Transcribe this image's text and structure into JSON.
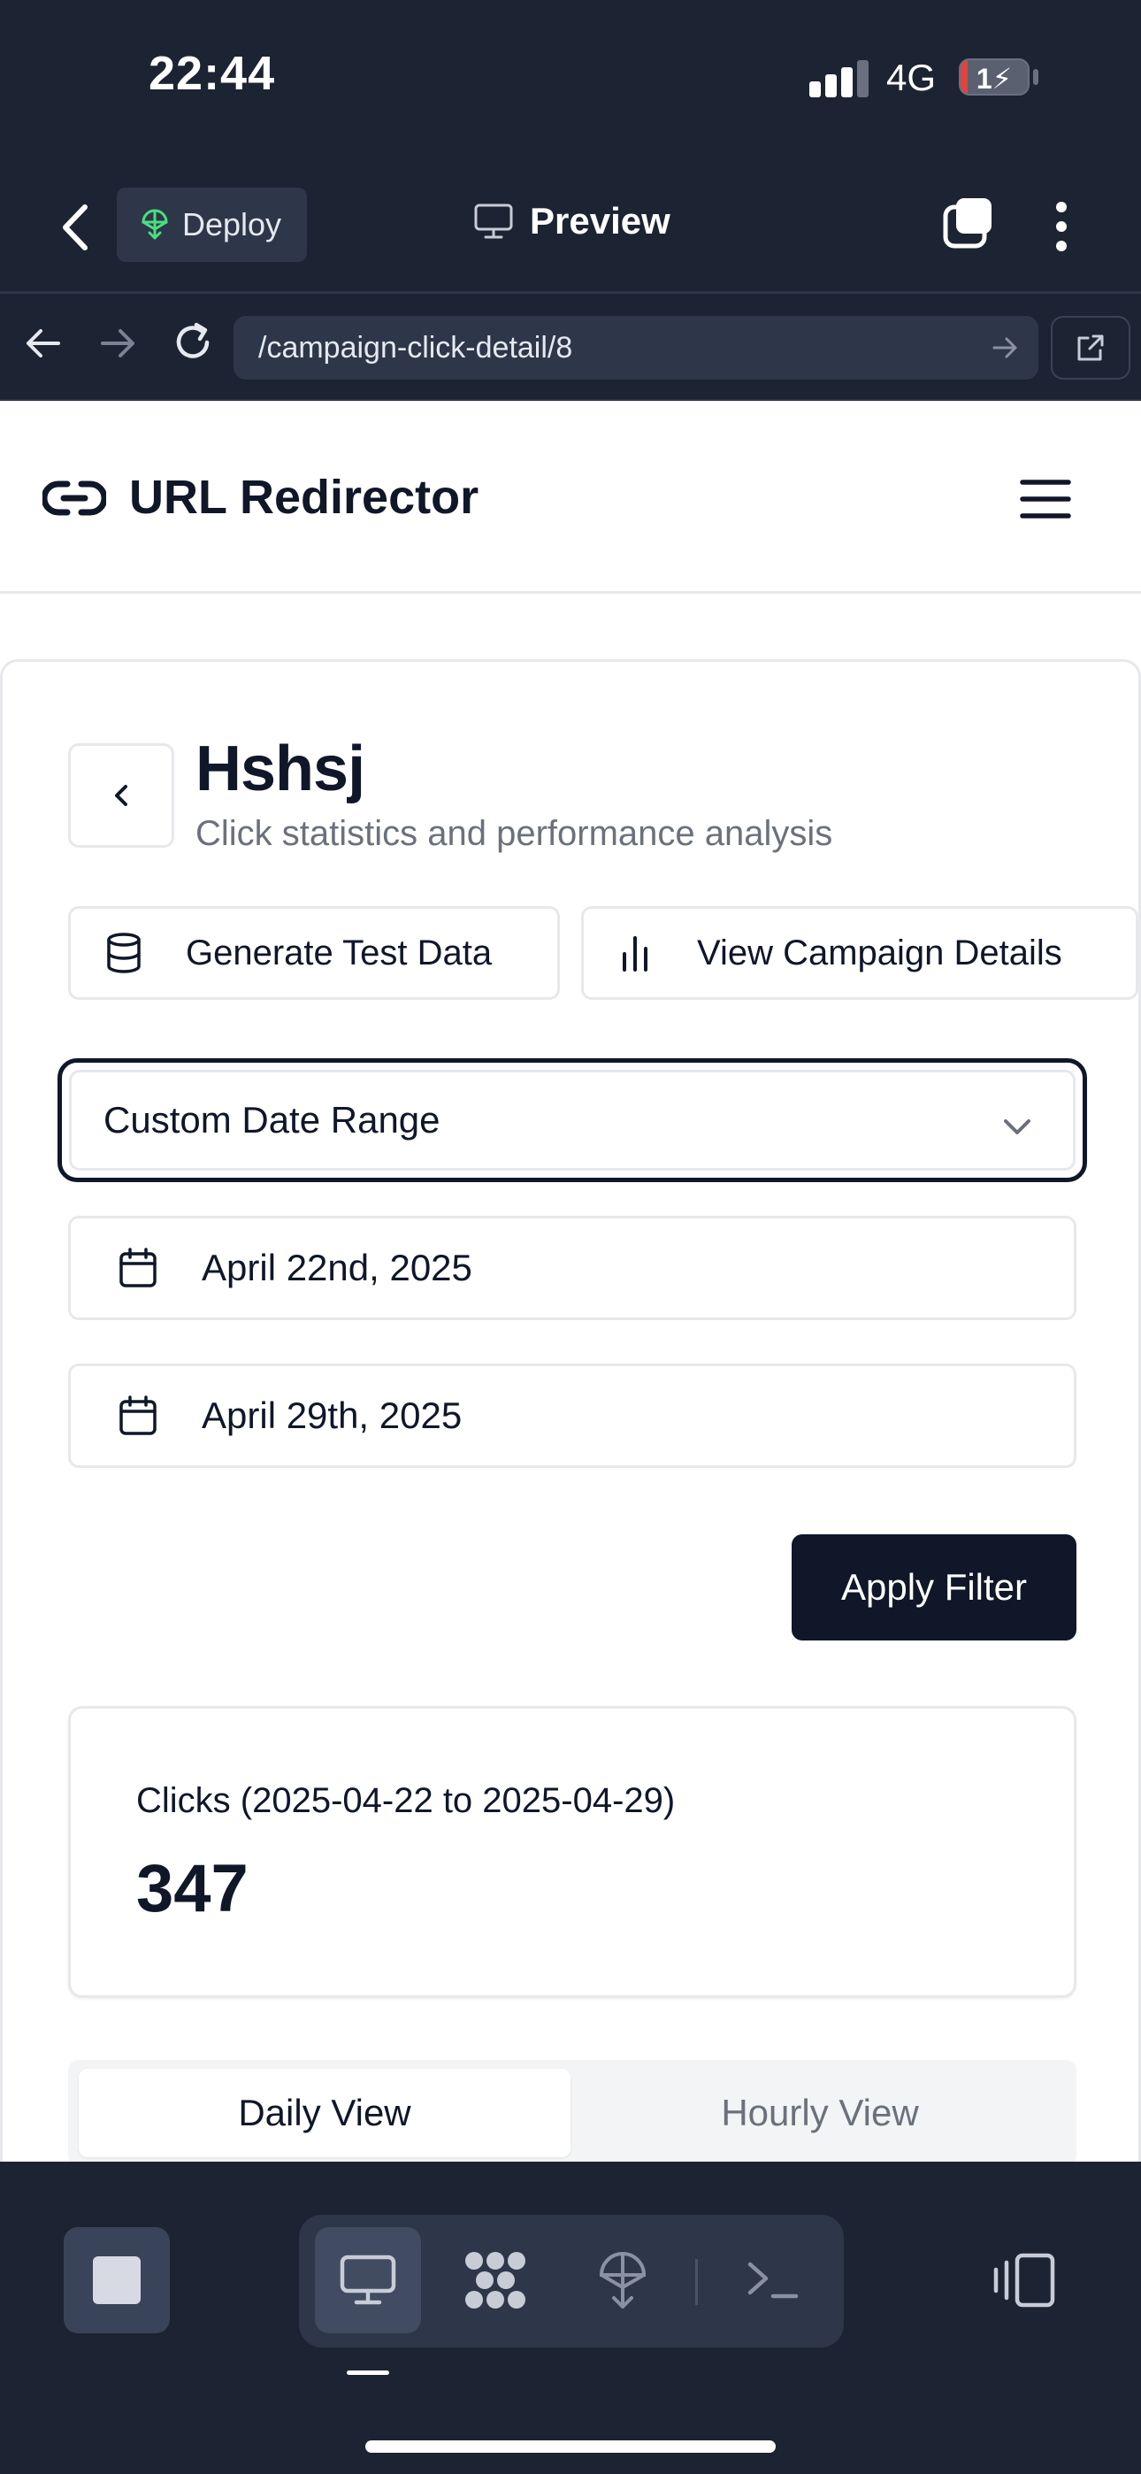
{
  "status_bar": {
    "time": "22:44",
    "network": "4G",
    "battery": "1"
  },
  "toolbar": {
    "deploy_label": "Deploy",
    "preview_label": "Preview"
  },
  "url_bar": {
    "url": "/campaign-click-detail/8"
  },
  "site": {
    "title": "URL Redirector"
  },
  "page": {
    "title": "Hshsj",
    "subtitle": "Click statistics and performance analysis",
    "generate_button": "Generate Test Data",
    "view_details_button": "View Campaign Details",
    "date_range_select": "Custom Date Range",
    "start_date": "April 22nd, 2025",
    "end_date": "April 29th, 2025",
    "apply_button": "Apply Filter"
  },
  "stats": {
    "label": "Clicks (2025-04-22 to 2025-04-29)",
    "value": "347"
  },
  "view_tabs": [
    {
      "label": "Daily View",
      "active": true
    },
    {
      "label": "Hourly View",
      "active": false
    }
  ],
  "colors": {
    "dark_bg": "#1c2333",
    "primary": "#0f1729",
    "border": "#e6e8eb",
    "muted": "#6b717c",
    "deploy_icon": "#4ade80"
  }
}
